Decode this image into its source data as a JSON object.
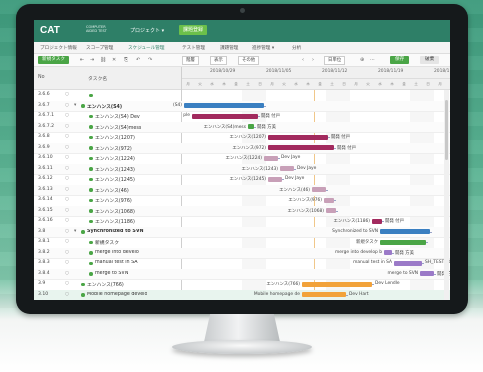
{
  "app": {
    "logo": "CAT",
    "logo_sub": "COMPUTER AIDED TEST",
    "project_menu": "プロジェクト ▾",
    "project_button": "課題登録"
  },
  "nav": {
    "items": [
      "プロジェクト情報",
      "スコープ管理",
      "スケジュール管理",
      "テスト管理",
      "課題管理",
      "進捗管理 ▾",
      "分析"
    ]
  },
  "toolbar": {
    "add_task": "新規タスク",
    "select_1": "階層",
    "select_2": "表示",
    "select_3": "その他",
    "select_4": "日単位",
    "save_button": "保存",
    "cancel_button": "破棄"
  },
  "columns": {
    "no": "No",
    "task": "タスク名"
  },
  "dates": [
    "2018/10/29",
    "2018/11/05",
    "2018/11/12",
    "2018/11/19",
    "2018/11/26"
  ],
  "days": [
    "月",
    "火",
    "水",
    "木",
    "金",
    "土",
    "日",
    "月",
    "火",
    "水",
    "木",
    "金",
    "土",
    "日",
    "月",
    "火",
    "水",
    "木",
    "金",
    "土",
    "日",
    "月"
  ],
  "rows": [
    {
      "id": "3.6.6",
      "name": "",
      "group": false
    },
    {
      "id": "3.6.7",
      "name": "エンハンス(S4)",
      "group": true
    },
    {
      "id": "3.6.7.1",
      "name": "エンハンス(S4) Dev",
      "group": false
    },
    {
      "id": "3.6.7.2",
      "name": "エンハンス(S4)mess",
      "group": false
    },
    {
      "id": "3.6.8",
      "name": "エンハンス(1207)",
      "group": false
    },
    {
      "id": "3.6.9",
      "name": "エンハンス(972)",
      "group": false
    },
    {
      "id": "3.6.10",
      "name": "エンハンス(1224)",
      "group": false
    },
    {
      "id": "3.6.11",
      "name": "エンハンス(1243)",
      "group": false
    },
    {
      "id": "3.6.12",
      "name": "エンハンス(1245)",
      "group": false
    },
    {
      "id": "3.6.13",
      "name": "エンハンス(46)",
      "group": false
    },
    {
      "id": "3.6.14",
      "name": "エンハンス(976)",
      "group": false
    },
    {
      "id": "3.6.15",
      "name": "エンハンス(1068)",
      "group": false
    },
    {
      "id": "3.6.16",
      "name": "エンハンス(1186)",
      "group": false
    },
    {
      "id": "3.8",
      "name": "Synchronized to SVN",
      "group": true
    },
    {
      "id": "3.8.1",
      "name": "新規タスク",
      "group": false
    },
    {
      "id": "3.8.2",
      "name": "merge into develo",
      "group": false
    },
    {
      "id": "3.8.3",
      "name": "manual test in SA",
      "group": false
    },
    {
      "id": "3.8.4",
      "name": "merge to SVN",
      "group": false
    },
    {
      "id": "3.9",
      "name": "エンハンス(766)",
      "group": false
    },
    {
      "id": "3.10",
      "name": "Mobile homepage develo",
      "group": false
    }
  ],
  "bars": [
    {
      "row": 1,
      "color": "#3a7fc1",
      "start": 0,
      "len": 80,
      "label_left": "(S4)",
      "label_right": ""
    },
    {
      "row": 2,
      "color": "#a22a5e",
      "start": 8,
      "len": 66,
      "label_left": "ple",
      "label_right": "開発 付戸"
    },
    {
      "row": 3,
      "color": "#4aa546",
      "start": 64,
      "len": 6,
      "label_left": "エンハンス(S4)mess",
      "label_right": "開発 方美"
    },
    {
      "row": 4,
      "color": "#a22a5e",
      "start": 84,
      "len": 60,
      "label_left": "エンハンス(1207)",
      "label_right": "開発 付戸"
    },
    {
      "row": 5,
      "color": "#a22a5e",
      "start": 84,
      "len": 66,
      "label_left": "エンハンス(972)",
      "label_right": "開発 付戸"
    },
    {
      "row": 6,
      "color": "#c8a0b8",
      "start": 80,
      "len": 14,
      "label_left": "エンハンス(1224)",
      "label_right": "Dev Jaye"
    },
    {
      "row": 7,
      "color": "#c8a0b8",
      "start": 96,
      "len": 14,
      "label_left": "エンハンス(1243)",
      "label_right": "Dev Jaye"
    },
    {
      "row": 8,
      "color": "#c8a0b8",
      "start": 84,
      "len": 14,
      "label_left": "エンハンス(1245)",
      "label_right": "Dev Jaye"
    },
    {
      "row": 9,
      "color": "#c8a0b8",
      "start": 128,
      "len": 14,
      "label_left": "エンハンス(46)",
      "label_right": ""
    },
    {
      "row": 10,
      "color": "#c8a0b8",
      "start": 140,
      "len": 10,
      "label_left": "エンハンス(976)",
      "label_right": ""
    },
    {
      "row": 11,
      "color": "#c8a0b8",
      "start": 142,
      "len": 10,
      "label_left": "エンハンス(1068)",
      "label_right": ""
    },
    {
      "row": 12,
      "color": "#a22a5e",
      "start": 188,
      "len": 10,
      "label_left": "エンハンス(1186)",
      "label_right": "開発 付戸"
    },
    {
      "row": 13,
      "color": "#3a7fc1",
      "start": 196,
      "len": 50,
      "label_left": "Synchronized to SVN",
      "label_right": ""
    },
    {
      "row": 14,
      "color": "#4aa546",
      "start": 196,
      "len": 46,
      "label_left": "新規タスク",
      "label_right": ""
    },
    {
      "row": 15,
      "color": "#9b7ac8",
      "start": 200,
      "len": 8,
      "label_left": "merge into develop b",
      "label_right": "開発 方美"
    },
    {
      "row": 16,
      "color": "#9b7ac8",
      "start": 210,
      "len": 28,
      "label_left": "manual test in SA",
      "label_right": "SH_TESTER"
    },
    {
      "row": 17,
      "color": "#9b7ac8",
      "start": 236,
      "len": 14,
      "label_left": "merge to SVN",
      "label_right": "開発 方美"
    },
    {
      "row": 18,
      "color": "#f2a23a",
      "start": 118,
      "len": 70,
      "label_left": "エンハンス(766)",
      "label_right": "Dev Lendle"
    },
    {
      "row": 19,
      "color": "#f2a23a",
      "start": 118,
      "len": 44,
      "label_left": "Mobile homepage de",
      "label_right": "Dev Hart"
    }
  ]
}
